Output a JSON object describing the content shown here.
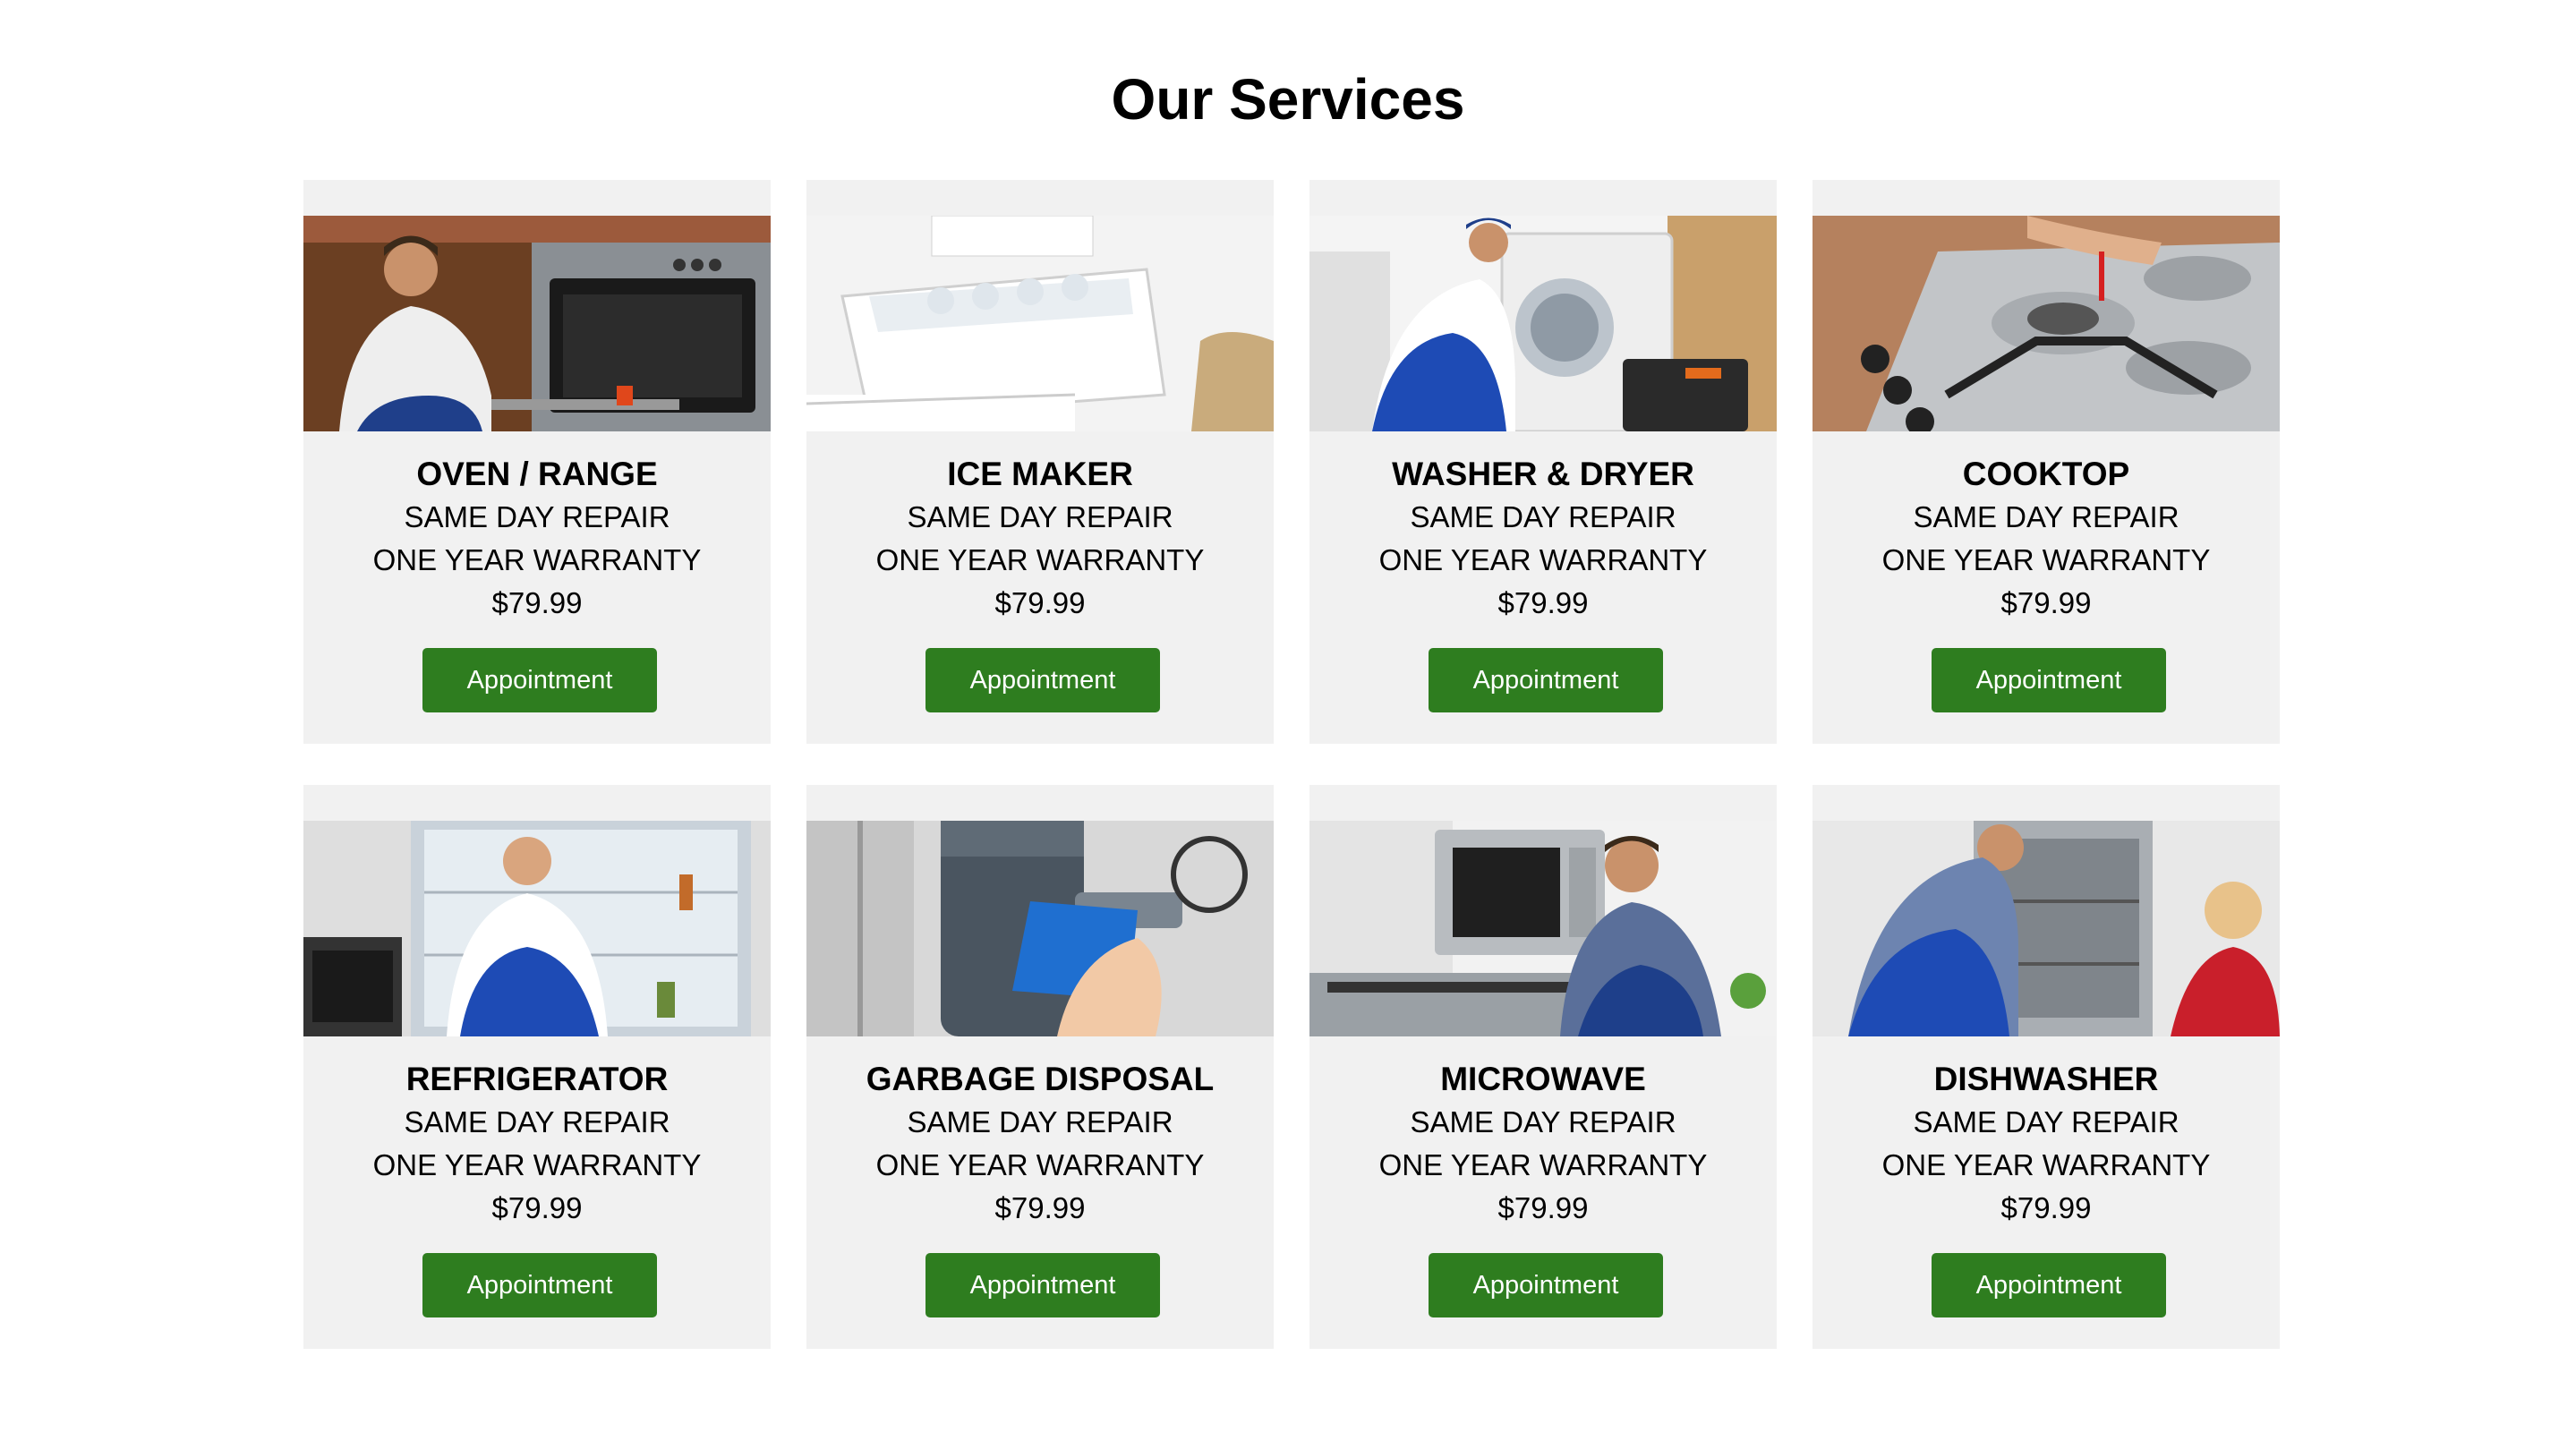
{
  "page": {
    "title": "Our Services"
  },
  "services": [
    {
      "name": "OVEN / RANGE",
      "line1": "SAME DAY REPAIR",
      "line2": "ONE YEAR WARRANTY",
      "price": "$79.99",
      "button": "Appointment",
      "image": "oven-repair-photo"
    },
    {
      "name": "ICE MAKER",
      "line1": "SAME DAY REPAIR",
      "line2": "ONE YEAR WARRANTY",
      "price": "$79.99",
      "button": "Appointment",
      "image": "ice-maker-photo"
    },
    {
      "name": "WASHER & DRYER",
      "line1": "SAME DAY REPAIR",
      "line2": "ONE YEAR WARRANTY",
      "price": "$79.99",
      "button": "Appointment",
      "image": "washer-repair-photo"
    },
    {
      "name": "COOKTOP",
      "line1": "SAME DAY REPAIR",
      "line2": "ONE YEAR WARRANTY",
      "price": "$79.99",
      "button": "Appointment",
      "image": "cooktop-repair-photo"
    },
    {
      "name": "REFRIGERATOR",
      "line1": "SAME DAY REPAIR",
      "line2": "ONE YEAR WARRANTY",
      "price": "$79.99",
      "button": "Appointment",
      "image": "refrigerator-repair-photo"
    },
    {
      "name": "GARBAGE DISPOSAL",
      "line1": "SAME DAY REPAIR",
      "line2": "ONE YEAR WARRANTY",
      "price": "$79.99",
      "button": "Appointment",
      "image": "garbage-disposal-photo"
    },
    {
      "name": "MICROWAVE",
      "line1": "SAME DAY REPAIR",
      "line2": "ONE YEAR WARRANTY",
      "price": "$79.99",
      "button": "Appointment",
      "image": "microwave-repair-photo"
    },
    {
      "name": "DISHWASHER",
      "line1": "SAME DAY REPAIR",
      "line2": "ONE YEAR WARRANTY",
      "price": "$79.99",
      "button": "Appointment",
      "image": "dishwasher-repair-photo"
    }
  ],
  "colors": {
    "button_bg": "#2e7d1f",
    "card_bg": "#f1f1f1",
    "button_text": "#ffffff"
  }
}
